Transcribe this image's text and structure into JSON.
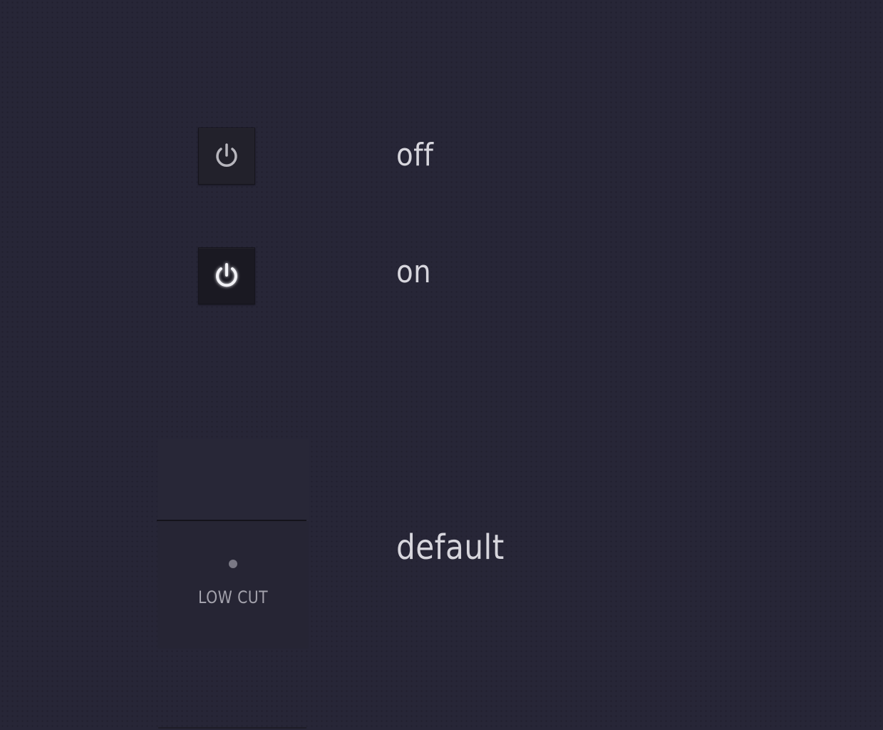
{
  "states": {
    "off_label": "off",
    "on_label": "on",
    "default_label": "default"
  },
  "power_buttons": [
    {
      "state": "off",
      "icon": "power-icon",
      "icon_color": "#b7b6bd"
    },
    {
      "state": "on",
      "icon": "power-icon",
      "icon_color": "#f2f2f6"
    }
  ],
  "lowcut": {
    "label": "LOW CUT",
    "led_icon": "indicator-dot-icon"
  },
  "colors": {
    "background": "#272637",
    "label_text": "#d7d6dd",
    "button_bg": "#1f1e29"
  }
}
